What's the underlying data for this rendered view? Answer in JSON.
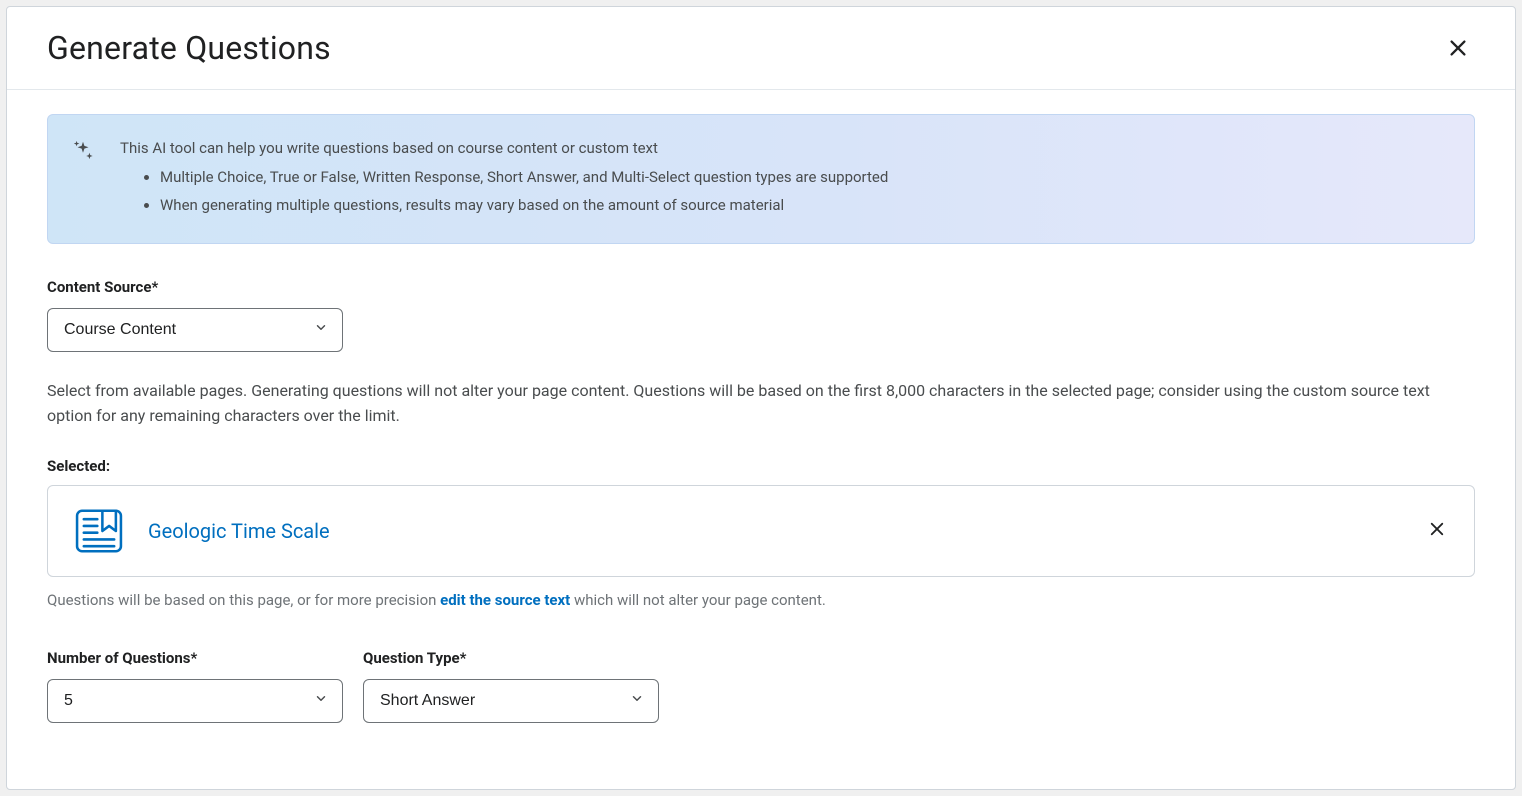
{
  "dialog": {
    "title": "Generate Questions"
  },
  "banner": {
    "intro": "This AI tool can help you write questions based on course content or custom text",
    "bullets": [
      "Multiple Choice, True or False, Written Response, Short Answer, and Multi-Select question types are supported",
      "When generating multiple questions, results may vary based on the amount of source material"
    ]
  },
  "content_source": {
    "label": "Content Source*",
    "value": "Course Content",
    "help": "Select from available pages. Generating questions will not alter your page content. Questions will be based on the first 8,000 characters in the selected page; consider using the custom source text option for any remaining characters over the limit."
  },
  "selected": {
    "label": "Selected:",
    "title": "Geologic Time Scale",
    "footnote_pre": "Questions will be based on this page, or for more precision ",
    "footnote_link": "edit the source text",
    "footnote_post": " which will not alter your page content."
  },
  "num_questions": {
    "label": "Number of Questions*",
    "value": "5"
  },
  "question_type": {
    "label": "Question Type*",
    "value": "Short Answer"
  }
}
